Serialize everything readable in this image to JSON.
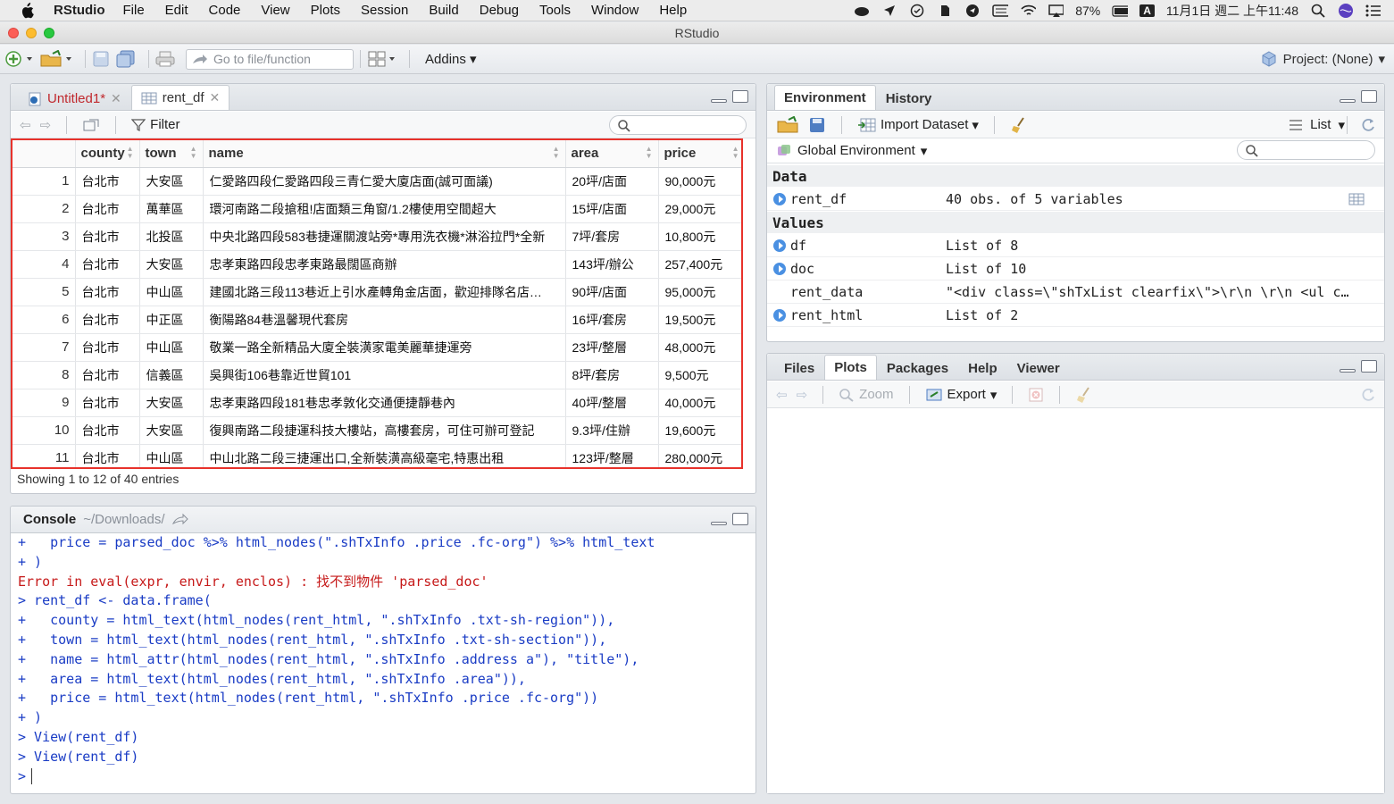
{
  "menubar": {
    "app_name": "RStudio",
    "items": [
      "File",
      "Edit",
      "Code",
      "View",
      "Plots",
      "Session",
      "Build",
      "Debug",
      "Tools",
      "Window",
      "Help"
    ],
    "battery": "87%",
    "input_method": "A",
    "datetime": "11月1日 週二 上午11:48"
  },
  "window": {
    "title": "RStudio"
  },
  "toolbar": {
    "goto_placeholder": "Go to file/function",
    "addins_label": "Addins",
    "project_label": "Project: (None)"
  },
  "source_pane": {
    "tabs": [
      {
        "label": "Untitled1*"
      },
      {
        "label": "rent_df"
      }
    ],
    "filter_label": "Filter",
    "columns": [
      "county",
      "town",
      "name",
      "area",
      "price"
    ],
    "rows": [
      [
        "1",
        "台北市",
        "大安區",
        "仁愛路四段仁愛路四段三青仁愛大廈店面(誠可面議)",
        "20坪/店面",
        "90,000元"
      ],
      [
        "2",
        "台北市",
        "萬華區",
        "環河南路二段搶租!店面類三角窗/1.2樓使用空間超大",
        "15坪/店面",
        "29,000元"
      ],
      [
        "3",
        "台北市",
        "北投區",
        "中央北路四段583巷捷運關渡站旁*專用洗衣機*淋浴拉門*全新",
        "7坪/套房",
        "10,800元"
      ],
      [
        "4",
        "台北市",
        "大安區",
        "忠孝東路四段忠孝東路最闊區商辦",
        "143坪/辦公",
        "257,400元"
      ],
      [
        "5",
        "台北市",
        "中山區",
        "建國北路三段113巷近上引水產轉角金店面，歡迎排隊名店…",
        "90坪/店面",
        "95,000元"
      ],
      [
        "6",
        "台北市",
        "中正區",
        "衡陽路84巷溫馨現代套房",
        "16坪/套房",
        "19,500元"
      ],
      [
        "7",
        "台北市",
        "中山區",
        "敬業一路全新精品大廈全裝潢家電美麗華捷運旁",
        "23坪/整層",
        "48,000元"
      ],
      [
        "8",
        "台北市",
        "信義區",
        "吳興街106巷靠近世貿101",
        "8坪/套房",
        "9,500元"
      ],
      [
        "9",
        "台北市",
        "大安區",
        "忠孝東路四段181巷忠孝敦化交通便捷靜巷內",
        "40坪/整層",
        "40,000元"
      ],
      [
        "10",
        "台北市",
        "大安區",
        "復興南路二段捷運科技大樓站，高樓套房，可住可辦可登記",
        "9.3坪/住辦",
        "19,600元"
      ],
      [
        "11",
        "台北市",
        "中山區",
        "中山北路二段三捷運出口,全新裝潢高級毫宅,特惠出租",
        "123坪/整層",
        "280,000元"
      ]
    ],
    "showing": "Showing 1 to 12 of 40 entries"
  },
  "console_pane": {
    "title": "Console",
    "path": "~/Downloads/",
    "lines": [
      {
        "text": "+   price = parsed_doc %>% html_nodes(\".shTxInfo .price .fc-org\") %>% html_text",
        "type": "code"
      },
      {
        "text": "+ )",
        "type": "code"
      },
      {
        "text": "Error in eval(expr, envir, enclos) : 找不到物件 'parsed_doc'",
        "type": "error"
      },
      {
        "text": "> rent_df <- data.frame(",
        "type": "code"
      },
      {
        "text": "+   county = html_text(html_nodes(rent_html, \".shTxInfo .txt-sh-region\")),",
        "type": "code"
      },
      {
        "text": "+   town = html_text(html_nodes(rent_html, \".shTxInfo .txt-sh-section\")),",
        "type": "code"
      },
      {
        "text": "+   name = html_attr(html_nodes(rent_html, \".shTxInfo .address a\"), \"title\"),",
        "type": "code"
      },
      {
        "text": "+   area = html_text(html_nodes(rent_html, \".shTxInfo .area\")),",
        "type": "code"
      },
      {
        "text": "+   price = html_text(html_nodes(rent_html, \".shTxInfo .price .fc-org\"))",
        "type": "code"
      },
      {
        "text": "+ )",
        "type": "code"
      },
      {
        "text": "> View(rent_df)",
        "type": "code"
      },
      {
        "text": "> View(rent_df)",
        "type": "code"
      },
      {
        "text": ">",
        "type": "prompt"
      }
    ]
  },
  "env_pane": {
    "tabs": [
      {
        "label": "Environment"
      },
      {
        "label": "History"
      }
    ],
    "import_label": "Import Dataset",
    "list_label": "List",
    "scope_label": "Global Environment",
    "sections": {
      "data": "Data",
      "values": "Values"
    },
    "data_rows": [
      {
        "name": "rent_df",
        "value": "40 obs. of 5 variables"
      }
    ],
    "value_rows": [
      {
        "name": "df",
        "value": "List of 8"
      },
      {
        "name": "doc",
        "value": "List of 10"
      },
      {
        "name": "rent_data",
        "value": "\"<div class=\\\"shTxList clearfix\\\">\\r\\n \\r\\n <ul c…"
      },
      {
        "name": "rent_html",
        "value": "List of 2"
      }
    ]
  },
  "files_pane": {
    "tabs": [
      {
        "label": "Files"
      },
      {
        "label": "Plots"
      },
      {
        "label": "Packages"
      },
      {
        "label": "Help"
      },
      {
        "label": "Viewer"
      }
    ],
    "zoom_label": "Zoom",
    "export_label": "Export"
  }
}
